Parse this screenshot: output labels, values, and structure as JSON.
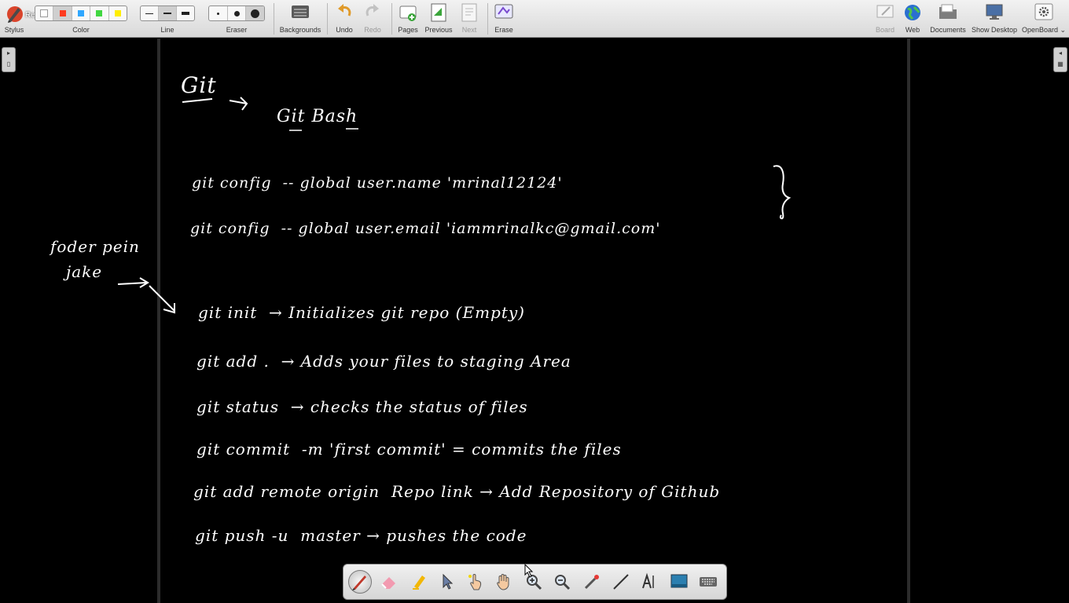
{
  "toolbar": {
    "recording_text": "Recording",
    "stylus": "Stylus",
    "color": "Color",
    "colors": [
      "#ffffff",
      "#ff3b1f",
      "#2fa7ff",
      "#41d741",
      "#ffee00"
    ],
    "line": "Line",
    "eraser": "Eraser",
    "backgrounds": "Backgrounds",
    "undo": "Undo",
    "redo": "Redo",
    "pages": "Pages",
    "previous": "Previous",
    "next": "Next",
    "erase": "Erase",
    "board": "Board",
    "web": "Web",
    "documents": "Documents",
    "show_desktop": "Show Desktop",
    "openboard": "OpenBoard"
  },
  "board": {
    "heading": "Git",
    "subheading": "Git Bash",
    "side_note_line1": "foder pein",
    "side_note_line2": "jake",
    "lines": [
      {
        "cmd": "git config",
        "rest": "-- global user.name  'mrinal12124'"
      },
      {
        "cmd": "git config",
        "rest": "-- global user.email  'iammrinalkc@gmail.com'"
      },
      {
        "cmd": "git init",
        "rest": "→ Initializes git repo (Empty)"
      },
      {
        "cmd": "git add .",
        "rest": "→ Adds your files to staging Area"
      },
      {
        "cmd": "git status",
        "rest": "→ checks the status of files"
      },
      {
        "cmd": "git commit",
        "rest": "-m 'first commit' = commits the files"
      },
      {
        "cmd": "git add remote origin",
        "rest": "Repo link → Add Repository of Github"
      },
      {
        "cmd": "git push -u",
        "rest": "master →    pushes   the code"
      }
    ]
  },
  "palette": {
    "tools": [
      "pen-icon",
      "eraser-icon",
      "highlighter-icon",
      "selector-icon",
      "interact-icon",
      "hand-icon",
      "zoom-in-icon",
      "zoom-out-icon",
      "laser-pointer-icon",
      "line-icon",
      "text-icon",
      "capture-icon",
      "keyboard-icon"
    ]
  }
}
